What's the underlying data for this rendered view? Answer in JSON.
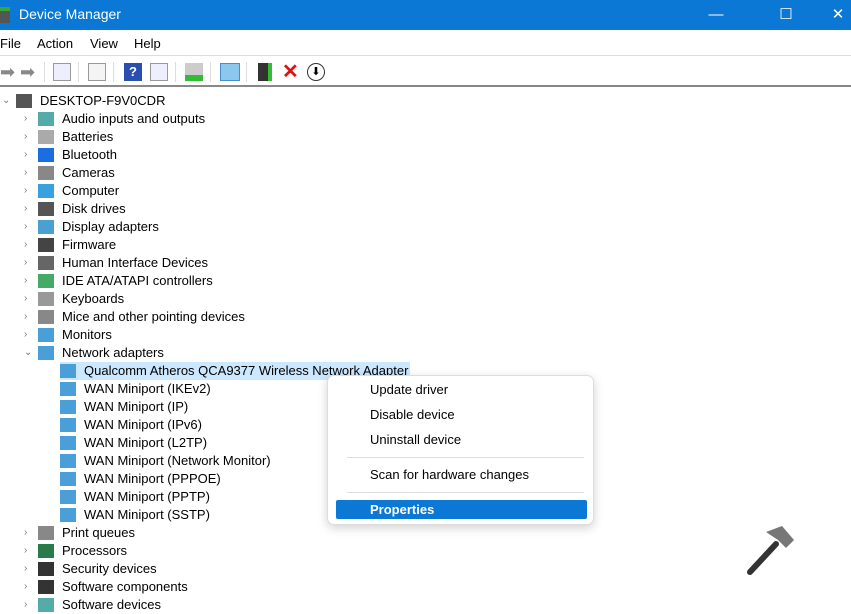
{
  "window": {
    "title": "Device Manager",
    "minimize": "—",
    "maximize": "☐",
    "close": "✕"
  },
  "menu": [
    "File",
    "Action",
    "View",
    "Help"
  ],
  "toolbar": [
    "back-icon",
    "forward-icon",
    "show-hide-console-tree-icon",
    "properties-icon",
    "help-icon",
    "action-pane-icon",
    "update-driver-icon",
    "scan-hardware-icon",
    "enable-device-icon",
    "uninstall-icon",
    "disable-device-icon"
  ],
  "tree": {
    "root": "DESKTOP-F9V0CDR",
    "categories_before": [
      "Audio inputs and outputs",
      "Batteries",
      "Bluetooth",
      "Cameras",
      "Computer",
      "Disk drives",
      "Display adapters",
      "Firmware",
      "Human Interface Devices",
      "IDE ATA/ATAPI controllers",
      "Keyboards",
      "Mice and other pointing devices",
      "Monitors"
    ],
    "expanded": "Network adapters",
    "children": [
      "Qualcomm Atheros QCA9377 Wireless Network Adapter",
      "WAN Miniport (IKEv2)",
      "WAN Miniport (IP)",
      "WAN Miniport (IPv6)",
      "WAN Miniport (L2TP)",
      "WAN Miniport (Network Monitor)",
      "WAN Miniport (PPPOE)",
      "WAN Miniport (PPTP)",
      "WAN Miniport (SSTP)"
    ],
    "categories_after": [
      "Print queues",
      "Processors",
      "Security devices",
      "Software components",
      "Software devices"
    ]
  },
  "context_menu": {
    "update": "Update driver",
    "disable": "Disable device",
    "uninstall": "Uninstall device",
    "scan": "Scan for hardware changes",
    "properties": "Properties"
  },
  "colors": {
    "accent": "#0a78d4",
    "selection": "#cce8ff"
  }
}
